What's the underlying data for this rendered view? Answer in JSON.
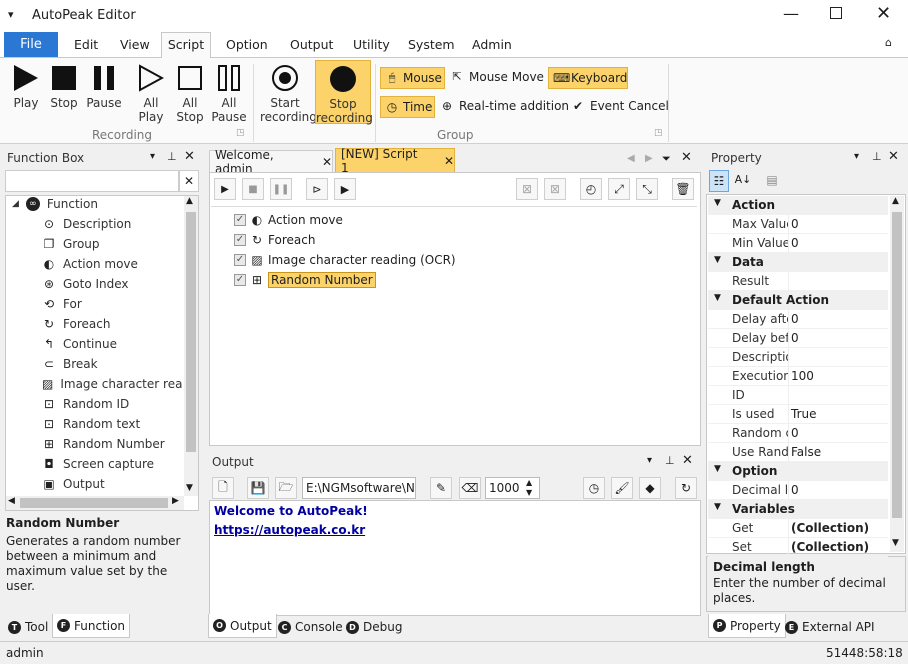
{
  "app": {
    "title": "AutoPeak Editor"
  },
  "menu": [
    "File",
    "Edit",
    "View",
    "Script",
    "Option",
    "Output",
    "Utility",
    "System",
    "Admin"
  ],
  "ribbon": {
    "recording_buttons": [
      "Play",
      "Stop",
      "Pause",
      "All Play",
      "All Stop",
      "All Pause",
      "Start recording",
      "Stop recording"
    ],
    "recording_group": "Recording",
    "group_items": [
      "Mouse",
      "Mouse Move",
      "Keyboard",
      "Time",
      "Real-time addition",
      "Event Cancel"
    ],
    "group_group": "Group"
  },
  "function_box": {
    "title": "Function Box",
    "root": "Function",
    "items": [
      "Description",
      "Group",
      "Action move",
      "Goto Index",
      "For",
      "Foreach",
      "Continue",
      "Break",
      "Image character readi",
      "Random ID",
      "Random text",
      "Random Number",
      "Screen capture",
      "Output"
    ],
    "selected_title": "Random Number",
    "selected_desc": "Generates a random number between a minimum and maximum value set by the user.",
    "tabs": [
      "Tool",
      "Function"
    ]
  },
  "editor": {
    "tabs": [
      "Welcome, admin",
      "[NEW] Script 1"
    ],
    "lines": [
      "Action move",
      "Foreach",
      "Image character reading (OCR)",
      "Random Number"
    ]
  },
  "output": {
    "title": "Output",
    "path": "E:\\NGMsoftware\\NG",
    "number": "1000",
    "line1": "Welcome to AutoPeak!",
    "line2": "https://autopeak.co.kr",
    "tabs": [
      "Output",
      "Console",
      "Debug"
    ]
  },
  "property": {
    "title": "Property",
    "rows": [
      {
        "cat": "Action"
      },
      {
        "n": "Max Value",
        "v": "0"
      },
      {
        "n": "Min Value",
        "v": "0"
      },
      {
        "cat": "Data"
      },
      {
        "n": "Result",
        "v": ""
      },
      {
        "cat": "Default Action"
      },
      {
        "n": "Delay afte",
        "v": "0"
      },
      {
        "n": "Delay befo",
        "v": "0"
      },
      {
        "n": "Descriptio",
        "v": ""
      },
      {
        "n": "Execution",
        "v": "100"
      },
      {
        "n": "ID",
        "v": ""
      },
      {
        "n": "Is used",
        "v": "True"
      },
      {
        "n": "Random c",
        "v": "0"
      },
      {
        "n": "Use Rando",
        "v": "False"
      },
      {
        "cat": "Option"
      },
      {
        "n": "Decimal le",
        "v": "0"
      },
      {
        "cat": "Variables"
      },
      {
        "n": "Get",
        "v": "(Collection)"
      },
      {
        "n": "Set",
        "v": "(Collection)"
      }
    ],
    "desc_title": "Decimal length",
    "desc_text": "Enter the number of decimal places.",
    "tabs": [
      "Property",
      "External API"
    ]
  },
  "status": {
    "user": "admin",
    "time": "51448:58:18"
  }
}
